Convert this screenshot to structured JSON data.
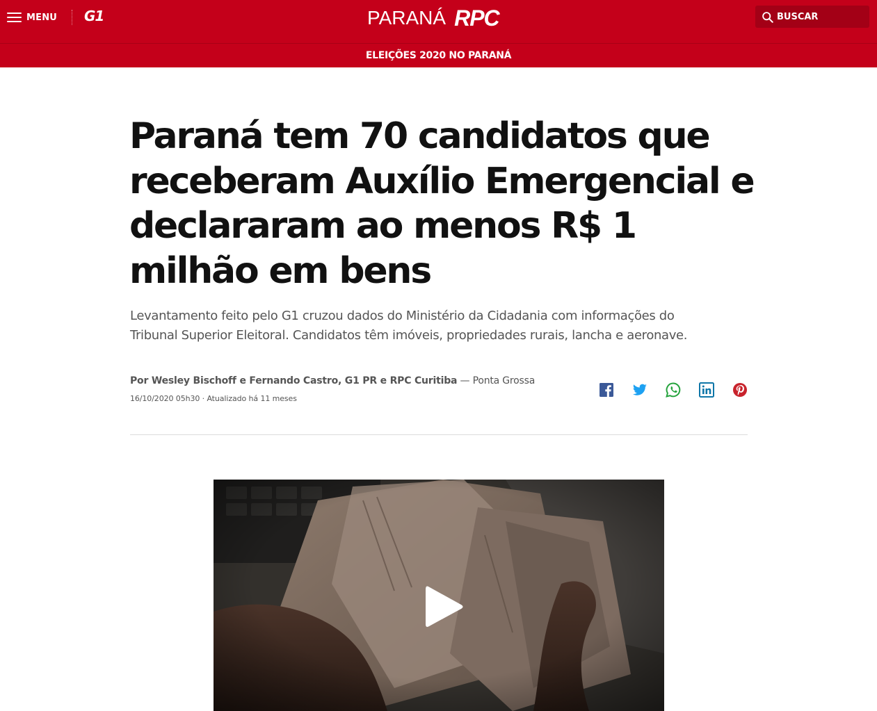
{
  "header": {
    "menu_label": "MENU",
    "g1_logo": "G1",
    "region": "PARANÁ",
    "station": "RPC",
    "search_label": "BUSCAR",
    "icons": [
      "menu-icon",
      "search-icon"
    ],
    "colors": {
      "brand_red": "#c4001a",
      "search_bg": "#a30016"
    }
  },
  "section": {
    "label": "ELEIÇÕES 2020 NO PARANÁ"
  },
  "article": {
    "headline": "Paraná tem 70 candidatos que receberam Auxílio Emergencial e declararam ao menos R$ 1 milhão em bens",
    "subtitle": "Levantamento feito pelo G1 cruzou dados do Ministério da Cidadania com informações do Tribunal Superior Eleitoral. Candidatos têm imóveis, propriedades rurais, lancha e aeronave.",
    "byline_authors": "Por Wesley Bischoff e Fernando Castro, G1 PR e RPC Curitiba",
    "byline_location": " — Ponta Grossa",
    "dateline": "16/10/2020 05h30 · Atualizado há 11 meses"
  },
  "share": {
    "icons": [
      "facebook-icon",
      "twitter-icon",
      "whatsapp-icon",
      "linkedin-icon",
      "pinterest-icon"
    ],
    "colors": {
      "facebook": "#3b5998",
      "twitter": "#1da1f2",
      "whatsapp": "#25a33d",
      "linkedin": "#0e76a8",
      "pinterest": "#c8232c"
    }
  },
  "video": {
    "thumbnail_icon": "video-thumbnail",
    "play_icon": "play-icon"
  }
}
